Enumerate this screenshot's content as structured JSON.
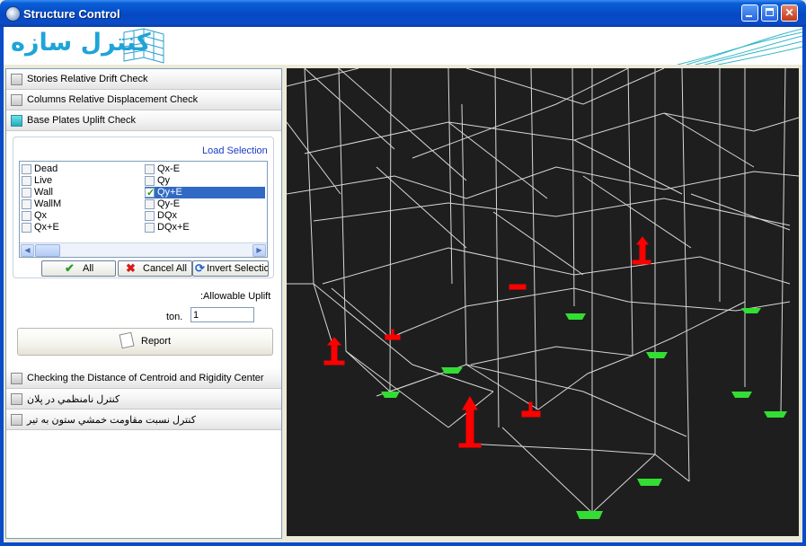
{
  "window": {
    "title": "Structure Control"
  },
  "banner": {
    "logo_text": "کنترل سازه"
  },
  "sections": [
    {
      "label": "Stories Relative Drift Check",
      "active": false
    },
    {
      "label": "Columns Relative Displacement Check",
      "active": false
    },
    {
      "label": "Base Plates Uplift Check",
      "active": true
    }
  ],
  "uplift": {
    "group_title": "Load Selection",
    "loads_left": [
      "Dead",
      "Live",
      "Wall",
      "WallM",
      "Qx",
      "Qx+E"
    ],
    "loads_right": [
      "Qx-E",
      "Qy",
      "Qy+E",
      "Qy-E",
      "DQx",
      "DQx+E"
    ],
    "checked": "Qy+E",
    "buttons": {
      "all": "All",
      "cancel_all": "Cancel All",
      "invert": "Invert Selection"
    },
    "allowable_label": ":Allowable Uplift",
    "ton_label": "ton.",
    "ton_value": "1",
    "report_label": "Report"
  },
  "sections_bottom": [
    {
      "label": "Checking the Distance of Centroid and Rigidity Center"
    },
    {
      "label": "کنترل نامنظمي در پلان"
    },
    {
      "label": "کنترل نسبت مقاومت خمشي ستون به تير"
    }
  ],
  "viewport": {
    "background": "#1e1e1e",
    "line_color": "#d8d8d8",
    "uplift_color": "#ff0000",
    "ok_color": "#33dd33"
  }
}
